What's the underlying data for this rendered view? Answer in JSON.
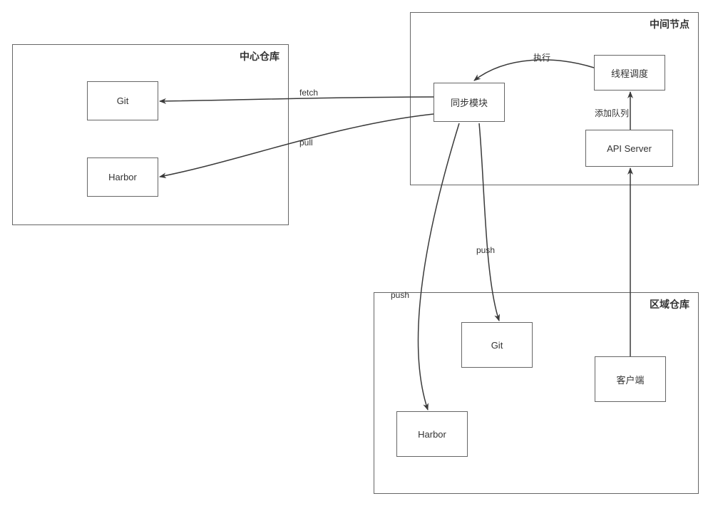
{
  "containers": {
    "central_repo": {
      "title": "中心仓库"
    },
    "middle_node": {
      "title": "中间节点"
    },
    "regional_repo": {
      "title": "区域仓库"
    }
  },
  "nodes": {
    "central_git": "Git",
    "central_harbor": "Harbor",
    "sync_module": "同步模块",
    "thread_sched": "线程调度",
    "api_server": "API Server",
    "regional_git": "Git",
    "regional_harbor": "Harbor",
    "client": "客户端"
  },
  "edges": {
    "fetch": "fetch",
    "pull": "pull",
    "execute": "执行",
    "add_queue": "添加队列",
    "push_git": "push",
    "push_harbor": "push"
  }
}
